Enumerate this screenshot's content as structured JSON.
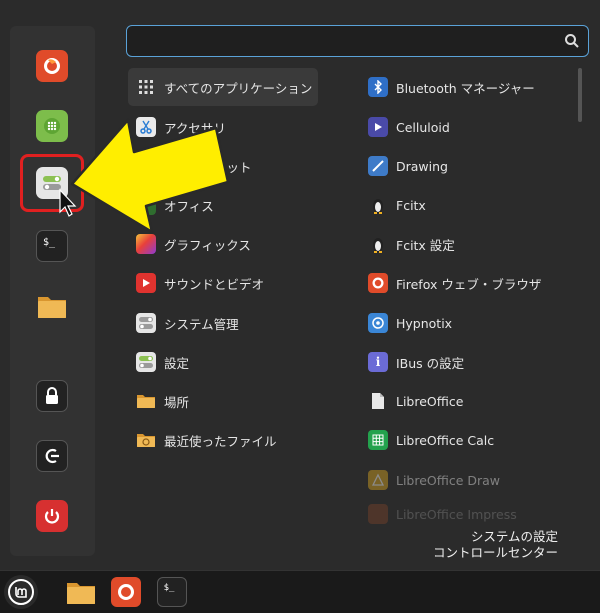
{
  "search": {
    "value": "",
    "placeholder": ""
  },
  "favorites": [
    {
      "name": "firefox",
      "color": "#e04b2a"
    },
    {
      "name": "software-manager",
      "color": "#7dbd4b"
    },
    {
      "name": "system-settings",
      "color": "#d8d8d8"
    },
    {
      "name": "terminal",
      "color": "#222222"
    },
    {
      "name": "files",
      "color": "#e8b04c"
    },
    {
      "name": "lock-screen",
      "color": "#222222"
    },
    {
      "name": "logout",
      "color": "#222222"
    },
    {
      "name": "shutdown",
      "color": "#d73030"
    }
  ],
  "categories": [
    {
      "label": "すべてのアプリケーション",
      "icon": "grid-icon"
    },
    {
      "label": "アクセサリ",
      "icon": "scissors-icon"
    },
    {
      "label": "インターネット",
      "icon": "globe-icon"
    },
    {
      "label": "オフィス",
      "icon": "office-icon"
    },
    {
      "label": "グラフィックス",
      "icon": "graphics-icon"
    },
    {
      "label": "サウンドとビデオ",
      "icon": "play-icon"
    },
    {
      "label": "システム管理",
      "icon": "toggle-icon"
    },
    {
      "label": "設定",
      "icon": "toggle-icon"
    },
    {
      "label": "場所",
      "icon": "folder-icon"
    },
    {
      "label": "最近使ったファイル",
      "icon": "recent-folder-icon"
    }
  ],
  "apps": [
    {
      "label": "Bluetooth マネージャー",
      "icon": "bluetooth-icon"
    },
    {
      "label": "Celluloid",
      "icon": "celluloid-icon"
    },
    {
      "label": "Drawing",
      "icon": "drawing-icon"
    },
    {
      "label": "Fcitx",
      "icon": "penguin-icon"
    },
    {
      "label": "Fcitx 設定",
      "icon": "penguin-icon"
    },
    {
      "label": "Firefox ウェブ・ブラウザ",
      "icon": "firefox-icon"
    },
    {
      "label": "Hypnotix",
      "icon": "hypnotix-icon"
    },
    {
      "label": "IBus の設定",
      "icon": "info-icon"
    },
    {
      "label": "LibreOffice",
      "icon": "document-icon"
    },
    {
      "label": "LibreOffice Calc",
      "icon": "calc-icon"
    },
    {
      "label": "LibreOffice Draw",
      "icon": "draw-icon"
    },
    {
      "label": "LibreOffice Impress",
      "icon": "impress-icon"
    }
  ],
  "description": {
    "title": "システムの設定",
    "subtitle": "コントロールセンター"
  },
  "colors": {
    "accent": "#5aa2d8",
    "highlight": "#e02020",
    "arrow": "#ffee00"
  }
}
